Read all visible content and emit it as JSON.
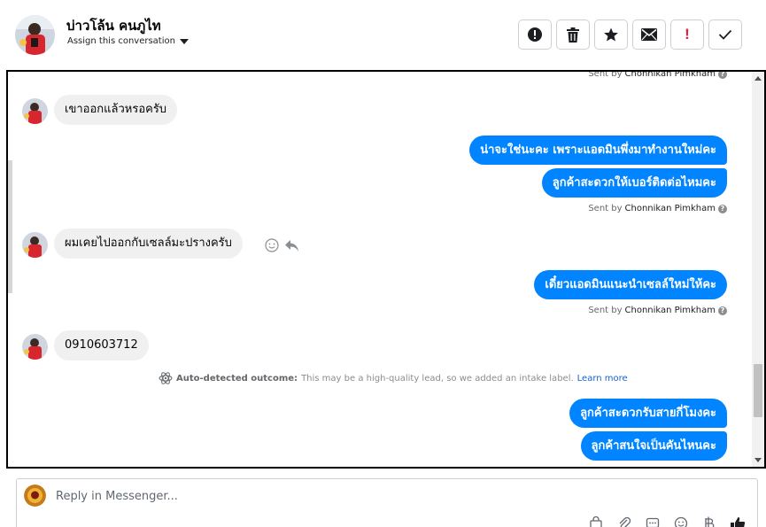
{
  "contact": {
    "name": "บ่าวโล้น คนภูไท",
    "assign_label": "Assign this conversation"
  },
  "toolbar": {
    "spam_icon": "alert-circle-icon",
    "delete_icon": "trash-icon",
    "star_icon": "star-icon",
    "mail_icon": "envelope-icon",
    "flag_text": "!",
    "done_icon": "check-icon"
  },
  "messages": {
    "top_sent_by_prefix": "Sent by",
    "top_sent_by_agent": "Chonnikan Pimkham",
    "m1": "เขาออกแล้วหรอครับ",
    "m2": "น่าจะใช่นะคะ เพราะแอดมินพึ่งมาทำงานใหม่คะ",
    "m3": "ลูกค้าสะดวกให้เบอร์ติดต่อไหมคะ",
    "s1_prefix": "Sent by",
    "s1_agent": "Chonnikan Pimkham",
    "m4": "ผมเคยไปออกกับเซลล์มะปรางครับ",
    "m5": "เดี๋ยวแอดมินแนะนำเซลล์ใหม่ให้คะ",
    "s2_prefix": "Sent by",
    "s2_agent": "Chonnikan Pimkham",
    "m6": "0910603712",
    "m7": "ลูกค้าสะดวกรับสายกี่โมงคะ",
    "m8": "ลูกค้าสนใจเป็นคันไหนคะ"
  },
  "auto_detect": {
    "label": "Auto-detected outcome:",
    "text": "This may be a high-quality lead, so we added an intake label.",
    "link": "Learn more"
  },
  "composer": {
    "placeholder": "Reply in Messenger...",
    "tools": [
      "shopping-bag-icon",
      "paperclip-icon",
      "saved-reply-icon",
      "emoji-icon",
      "currency-icon",
      "thumbs-up-icon"
    ]
  },
  "colors": {
    "outgoing_bubble": "#0084ff",
    "incoming_bubble": "#f0f0f0",
    "link": "#1763cf"
  }
}
